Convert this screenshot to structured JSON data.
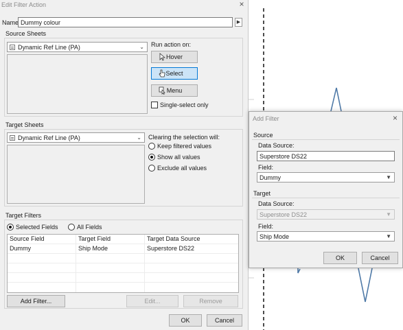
{
  "main_dialog": {
    "title": "Edit Filter Action",
    "close_glyph": "×",
    "name_label": "Name:",
    "name_value": "Dummy colour",
    "name_menu_glyph": "▶",
    "source_sheets": {
      "legend": "Source Sheets",
      "selected": "Dynamic Ref Line (PA)",
      "run_action_label": "Run action on:",
      "buttons": [
        {
          "label": "Hover",
          "icon": "pointer-icon",
          "selected": false
        },
        {
          "label": "Select",
          "icon": "hand-pointer-icon",
          "selected": true
        },
        {
          "label": "Menu",
          "icon": "menu-icon",
          "selected": false
        }
      ],
      "single_select_label": "Single-select only",
      "single_select_checked": false
    },
    "target_sheets": {
      "legend": "Target Sheets",
      "selected": "Dynamic Ref Line (PA)",
      "clearing_label": "Clearing the selection will:",
      "options": [
        {
          "label": "Keep filtered values",
          "checked": false
        },
        {
          "label": "Show all values",
          "checked": true
        },
        {
          "label": "Exclude all values",
          "checked": false
        }
      ]
    },
    "target_filters": {
      "legend": "Target Filters",
      "radio_selected_fields": "Selected Fields",
      "radio_all_fields": "All Fields",
      "columns": [
        "Source Field",
        "Target Field",
        "Target Data Source"
      ],
      "rows": [
        [
          "Dummy",
          "Ship Mode",
          "Superstore DS22"
        ]
      ],
      "add_button": "Add Filter...",
      "edit_button": "Edit...",
      "remove_button": "Remove"
    },
    "ok_button": "OK",
    "cancel_button": "Cancel"
  },
  "add_filter_dialog": {
    "title": "Add Filter",
    "close_glyph": "×",
    "source_legend": "Source",
    "source_data_source_label": "Data Source:",
    "source_data_source_value": "Superstore DS22",
    "source_field_label": "Field:",
    "source_field_value": "Dummy",
    "target_legend": "Target",
    "target_data_source_label": "Data Source:",
    "target_data_source_value": "Superstore DS22",
    "target_field_label": "Field:",
    "target_field_value": "Ship Mode",
    "ok_button": "OK",
    "cancel_button": "Cancel"
  },
  "colors": {
    "dialog_bg": "#f0f0f0",
    "selected_button": "#cce4f7",
    "selected_border": "#0078d7",
    "line_series": "#4e79a7",
    "ref_line": "#000000"
  }
}
